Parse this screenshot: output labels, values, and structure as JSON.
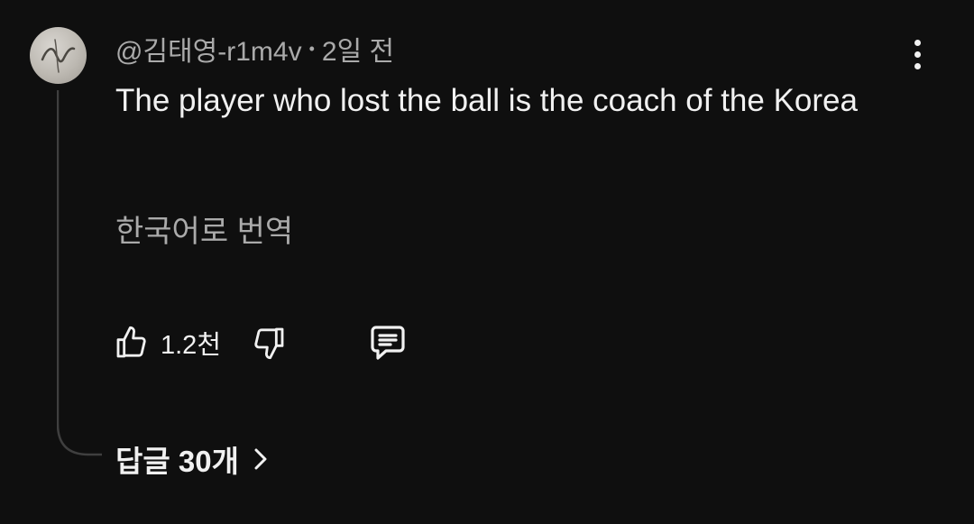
{
  "comment": {
    "author": "@김태영-r1m4v",
    "separator": "•",
    "time": "2일 전",
    "text": "The player who lost the ball is the coach of the Korea",
    "translate_label": "한국어로 번역"
  },
  "actions": {
    "like_count": "1.2천"
  },
  "replies": {
    "label": "답글 30개"
  },
  "icons": {
    "avatar": "avatar-image",
    "menu": "more-vertical-icon",
    "like": "thumbs-up-icon",
    "dislike": "thumbs-down-icon",
    "reply": "reply-comment-icon",
    "replies_toggle": "chevron-right-icon"
  },
  "colors": {
    "background": "#0f0f0f",
    "text_primary": "#f1f1f1",
    "text_secondary": "#aaaaaa",
    "thread_line": "#3f3f3f"
  }
}
